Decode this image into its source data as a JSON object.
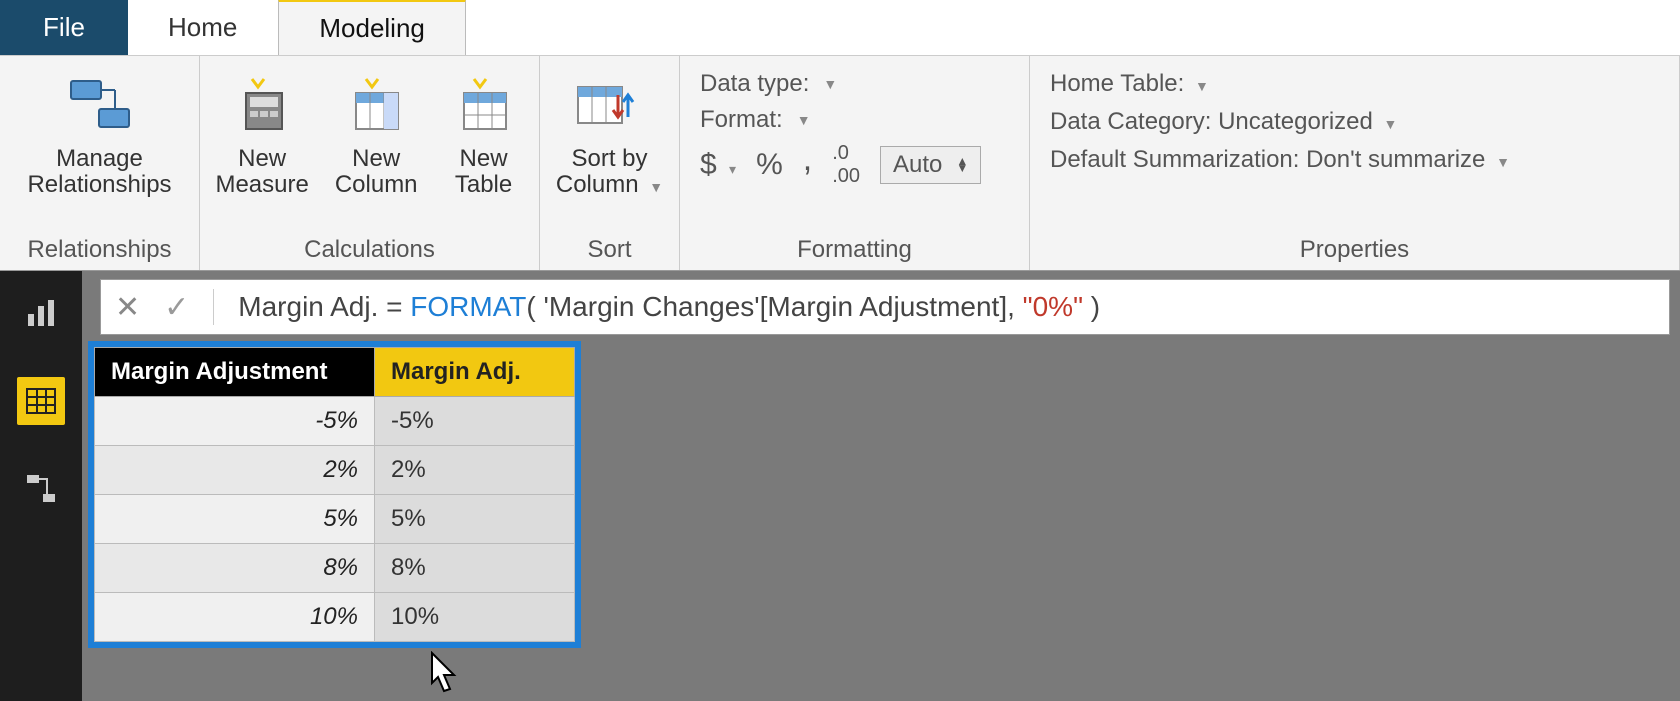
{
  "tabs": {
    "file": "File",
    "home": "Home",
    "modeling": "Modeling",
    "active": "modeling"
  },
  "ribbon": {
    "relationships": {
      "manage": "Manage\nRelationships",
      "group": "Relationships"
    },
    "calculations": {
      "measure": "New\nMeasure",
      "column": "New\nColumn",
      "table": "New\nTable",
      "group": "Calculations"
    },
    "sort": {
      "btn": "Sort by\nColumn",
      "group": "Sort"
    },
    "formatting": {
      "dataType": "Data type:",
      "format": "Format:",
      "currency": "$",
      "percent": "%",
      "thousand": ",",
      "decimals": ".00",
      "auto": "Auto",
      "group": "Formatting"
    },
    "properties": {
      "homeTable": "Home Table:",
      "dataCategory": "Data Category: Uncategorized",
      "summarization": "Default Summarization: Don't summarize",
      "group": "Properties"
    }
  },
  "formula": {
    "prefix": "Margin Adj. = ",
    "fn": "FORMAT",
    "open": "(",
    "arg": " 'Margin Changes'[Margin Adjustment], ",
    "str": "\"0%\"",
    "close": " )"
  },
  "table": {
    "headers": {
      "a": "Margin Adjustment",
      "b": "Margin Adj."
    },
    "rows": [
      {
        "a": "-5%",
        "b": "-5%"
      },
      {
        "a": "2%",
        "b": "2%"
      },
      {
        "a": "5%",
        "b": "5%"
      },
      {
        "a": "8%",
        "b": "8%"
      },
      {
        "a": "10%",
        "b": "10%"
      }
    ]
  },
  "sidenav": {
    "active": 1
  }
}
